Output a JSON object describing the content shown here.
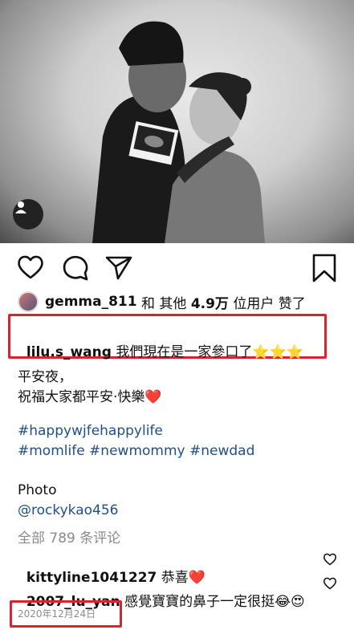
{
  "post": {
    "liked_by_user": "gemma_811",
    "liked_by_and": "和 其他",
    "liked_by_count": "4.9万",
    "liked_by_suffix": "位用户 赞了",
    "caption_user": "lilu.s_wang",
    "caption_text": "我們現在是一家參口了⭐⭐⭐",
    "body_line1": "平安夜，",
    "body_line2": "祝福大家都平安·快樂❤️",
    "hashtags_line1": "#happywjfehappylife",
    "hashtags_line2": "#momlife #newmommy #newdad",
    "photo_credit_label": "Photo",
    "photo_credit_handle": "@rockykao456",
    "view_comments": "全部 789 条评论",
    "comments": [
      {
        "user": "kittyline1041227",
        "text": "恭喜❤️"
      },
      {
        "user": "2007_lu_yan",
        "text": "感覺寶寶的鼻子一定很挺😂😍"
      }
    ],
    "date": "2020年12月24日"
  },
  "icons": {
    "like": "heart-icon",
    "comment": "comment-icon",
    "share": "send-icon",
    "save": "bookmark-icon",
    "tag": "user-tag-icon"
  },
  "colors": {
    "highlight": "#d9232e",
    "hashtag": "#1d4f8c"
  }
}
